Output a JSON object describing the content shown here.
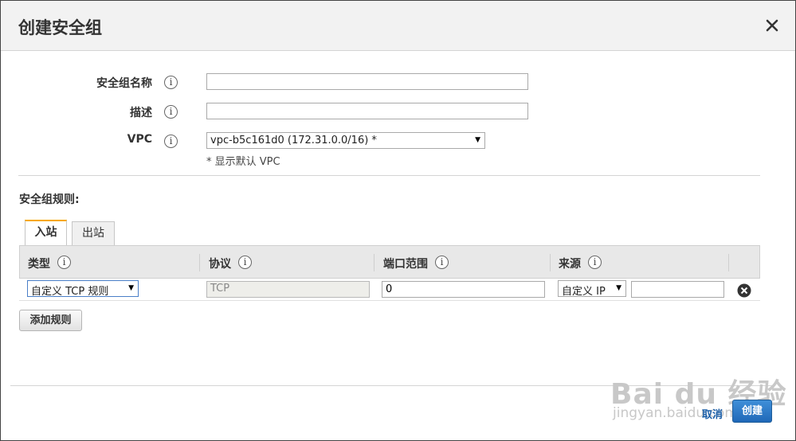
{
  "dialog": {
    "title": "创建安全组",
    "close_icon": "close-icon"
  },
  "form": {
    "name_label": "安全组名称",
    "name_value": "",
    "description_label": "描述",
    "description_value": "",
    "vpc_label": "VPC",
    "vpc_selected": "vpc-b5c161d0 (172.31.0.0/16) *",
    "vpc_hint": "* 显示默认 VPC",
    "info_glyph": "i"
  },
  "rules": {
    "section_title": "安全组规则:",
    "tabs": [
      {
        "label": "入站",
        "active": true
      },
      {
        "label": "出站",
        "active": false
      }
    ],
    "columns": [
      "类型",
      "协议",
      "端口范围",
      "来源"
    ],
    "rows": [
      {
        "type": "自定义 TCP 规则",
        "protocol": "TCP",
        "port_range": "0",
        "source_type": "自定义 IP",
        "source_value": ""
      }
    ],
    "add_rule_label": "添加规则"
  },
  "footer": {
    "cancel_label": "取消",
    "create_label": "创建"
  },
  "watermark": {
    "brand": "Bai du 经验",
    "url": "jingyan.baidu.com"
  },
  "colors": {
    "accent_tab": "#f7a800",
    "primary_button": "#1f68b8",
    "link": "#1a5ea8"
  }
}
